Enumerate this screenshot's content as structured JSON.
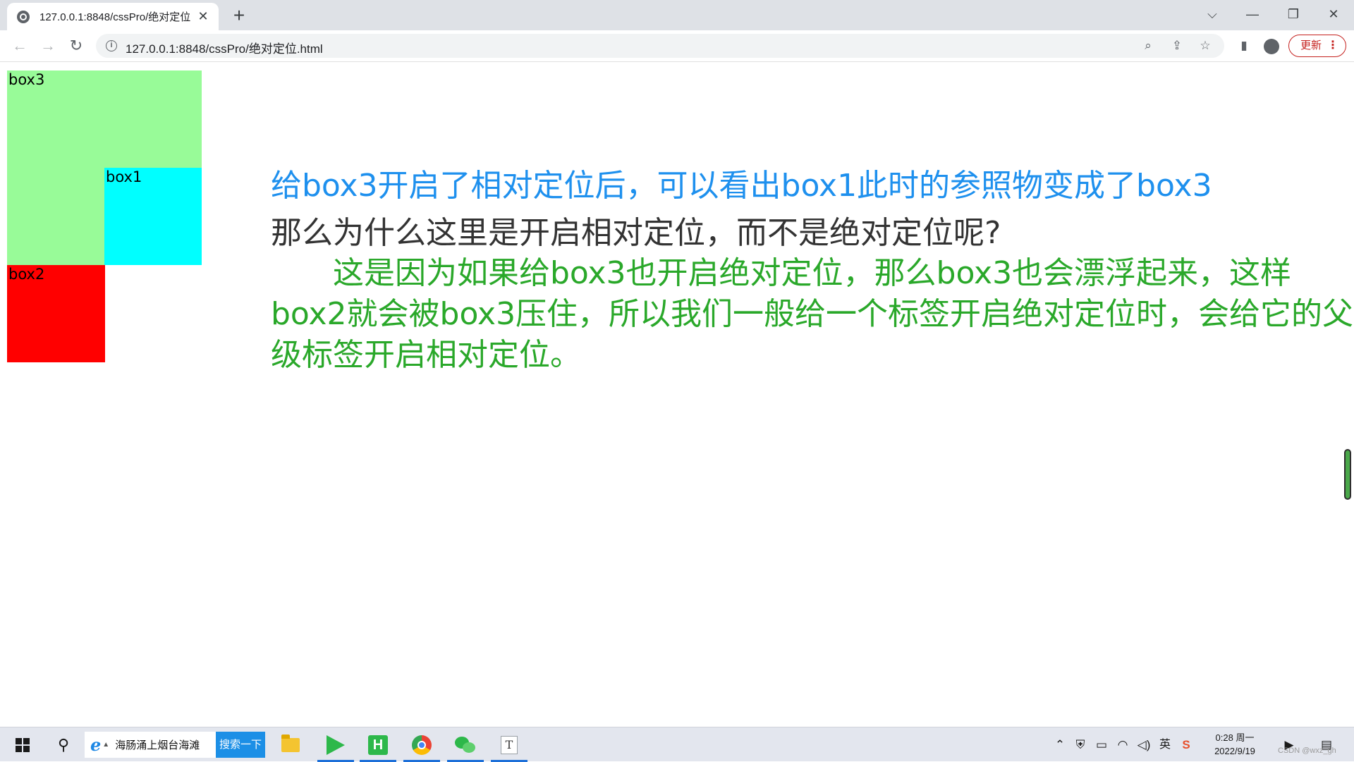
{
  "browser": {
    "tab_title": "127.0.0.1:8848/cssPro/绝对定位",
    "tab_close": "✕",
    "new_tab": "+",
    "url": "127.0.0.1:8848/cssPro/绝对定位.html",
    "update_label": "更新",
    "controls": {
      "tab_list": "⌵",
      "minimize": "—",
      "maximize": "❐",
      "close": "✕"
    }
  },
  "page": {
    "boxes": {
      "box3": "box3",
      "box1": "box1",
      "box2": "box2"
    },
    "box_colors": {
      "box3": "#98fb98",
      "box1": "#00ffff",
      "box2": "#ff0000"
    },
    "line1": "给box3开启了相对定位后，可以看出box1此时的参照物变成了box3",
    "line1_color": "#1e90ee",
    "line2": "那么为什么这里是开启相对定位，而不是绝对定位呢?",
    "line2_color": "#333333",
    "paragraph": "这是因为如果给box3也开启绝对定位，那么box3也会漂浮起来，这样box2就会被box3压住，所以我们一般给一个标签开启绝对定位时，会给它的父级标签开启相对定位。",
    "paragraph_color": "#2aa82a"
  },
  "taskbar": {
    "search_text": "海肠涌上烟台海滩",
    "search_button": "搜索一下",
    "hbuilder_letter": "H",
    "typora_letter": "T",
    "ime_label": "英",
    "sogou_label": "S",
    "clock_time": "0:28 周一",
    "clock_date": "2022/9/19",
    "watermark": "CSDN @wxz_gh"
  },
  "icons": {
    "favicon": "globe-icon",
    "back": "arrow-left-icon",
    "forward": "arrow-right-icon",
    "reload": "reload-icon",
    "site_info": "info-icon",
    "zoom": "zoom-icon",
    "share": "share-icon",
    "bookmark": "star-icon",
    "side_panel": "side-panel-icon",
    "profile": "profile-icon",
    "menu": "kebab-menu-icon"
  }
}
